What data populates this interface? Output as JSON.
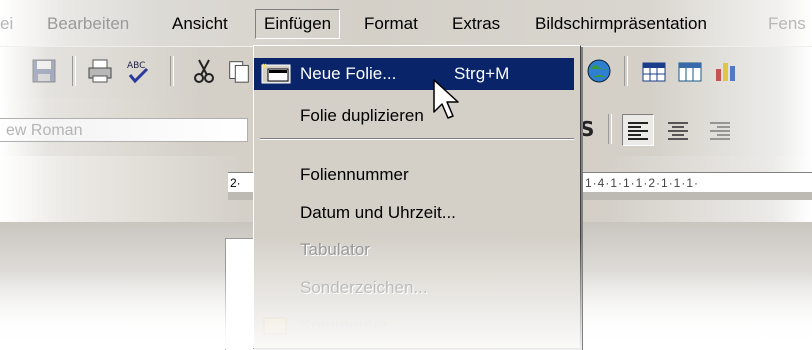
{
  "menubar": {
    "items": [
      {
        "label": "ei",
        "key": "datei-partial"
      },
      {
        "label": "Bearbeiten"
      },
      {
        "label": "Ansicht"
      },
      {
        "label": "Einfügen"
      },
      {
        "label": "Format"
      },
      {
        "label": "Extras"
      },
      {
        "label": "Bildschirmpräsentation"
      },
      {
        "label": "Fens"
      }
    ]
  },
  "formatbar": {
    "font_name": "ew Roman"
  },
  "ruler": {
    "left_label": "2·",
    "right_label": "·1·4·1·1·1·2·1·1·1·"
  },
  "dropdown": {
    "items": [
      {
        "label": "Neue Folie...",
        "shortcut": "Strg+M",
        "state": "highlighted",
        "icon": "new-slide-icon"
      },
      {
        "label": "Folie duplizieren",
        "state": "enabled"
      },
      {
        "label": "Foliennummer",
        "state": "enabled"
      },
      {
        "label": "Datum und Uhrzeit...",
        "state": "enabled"
      },
      {
        "label": "Tabulator",
        "state": "disabled"
      },
      {
        "label": "Sonderzeichen...",
        "state": "disabled"
      },
      {
        "label": "Kommentar",
        "state": "faded"
      }
    ]
  },
  "colors": {
    "highlight": "#0a246a",
    "menu_bg": "#d4d0c8"
  }
}
